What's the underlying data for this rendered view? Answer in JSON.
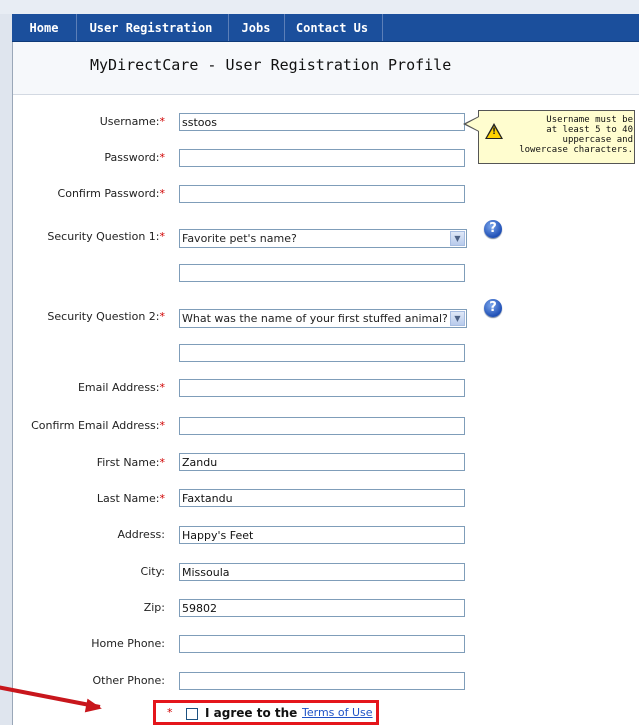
{
  "nav": {
    "items": [
      "Home",
      "User Registration",
      "Jobs",
      "Contact Us"
    ]
  },
  "page": {
    "title": "MyDirectCare - User Registration Profile"
  },
  "form": {
    "required_mark": "*",
    "username": {
      "label": "Username:",
      "value": "sstoos"
    },
    "password": {
      "label": "Password:",
      "value": ""
    },
    "confirm_password": {
      "label": "Confirm Password:",
      "value": ""
    },
    "security_q1": {
      "label": "Security Question 1:",
      "selected": "Favorite pet's name?",
      "answer": ""
    },
    "security_q2": {
      "label": "Security Question 2:",
      "selected": "What was the name of your first stuffed animal?",
      "answer": ""
    },
    "email": {
      "label": "Email Address:",
      "value": ""
    },
    "confirm_email": {
      "label": "Confirm Email Address:",
      "value": ""
    },
    "first_name": {
      "label": "First Name:",
      "value": "Zandu"
    },
    "last_name": {
      "label": "Last Name:",
      "value": "Faxtandu"
    },
    "address": {
      "label": "Address:",
      "value": "Happy's Feet"
    },
    "city": {
      "label": "City:",
      "value": "Missoula"
    },
    "zip": {
      "label": "Zip:",
      "value": "59802"
    },
    "home_phone": {
      "label": "Home Phone:",
      "value": ""
    },
    "other_phone": {
      "label": "Other Phone:",
      "value": ""
    }
  },
  "tooltip": {
    "lines": [
      "Username must be",
      "at least 5 to 40",
      "uppercase and",
      "lowercase characters."
    ]
  },
  "help_icon_glyph": "?",
  "warning_glyph": "!",
  "dropdown_glyph": "▼",
  "agreement": {
    "text": "I agree to the",
    "link": "Terms of Use"
  },
  "colors": {
    "nav_bg": "#1b4f9c",
    "required": "#d00000",
    "highlight": "#e4151b",
    "link": "#1f53c7"
  }
}
